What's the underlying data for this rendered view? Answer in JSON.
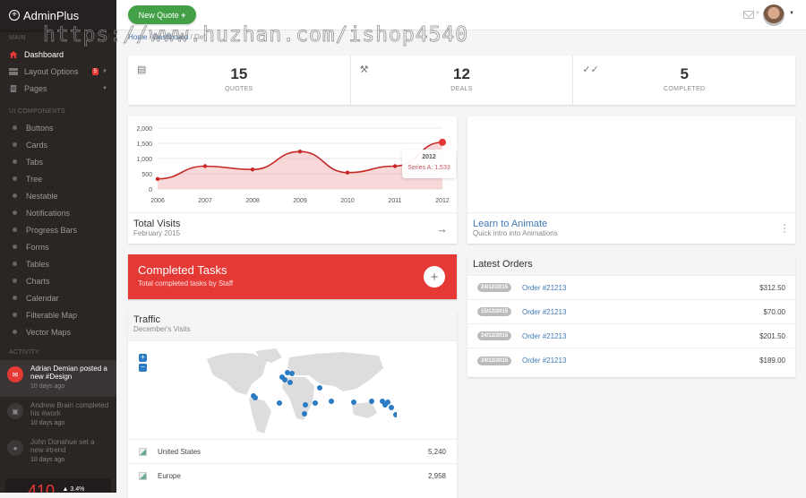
{
  "app": {
    "title": "AdminPlus"
  },
  "watermark": "https://www.huzhan.com/ishop4540",
  "sidebar": {
    "sections": {
      "main": "MAIN",
      "ui": "UI COMPONENTS",
      "activity": "ACTIVITY"
    },
    "main_items": [
      {
        "label": "Dashboard",
        "icon": "home-icon",
        "active": true
      },
      {
        "label": "Layout Options",
        "icon": "layout-icon",
        "badge": "5"
      },
      {
        "label": "Pages",
        "icon": "pages-icon"
      }
    ],
    "ui_items": [
      {
        "label": "Buttons"
      },
      {
        "label": "Cards"
      },
      {
        "label": "Tabs"
      },
      {
        "label": "Tree"
      },
      {
        "label": "Nestable"
      },
      {
        "label": "Notifications"
      },
      {
        "label": "Progress Bars"
      },
      {
        "label": "Forms"
      },
      {
        "label": "Tables"
      },
      {
        "label": "Charts"
      },
      {
        "label": "Calendar"
      },
      {
        "label": "Filterable Map"
      },
      {
        "label": "Vector Maps"
      }
    ],
    "activity": [
      {
        "text": "Adrian Demian posted a new #Design",
        "time": "10 days ago",
        "icon": "mail-icon"
      },
      {
        "text": "Andrew Brain completed his #work",
        "time": "10 days ago",
        "icon": "calendar-icon"
      },
      {
        "text": "John Donahue set a new #trend",
        "time": "10 days ago",
        "icon": "user-icon"
      }
    ],
    "stat": {
      "value": "410",
      "change": "▲ 3.4%"
    }
  },
  "topbar": {
    "new_quote": "New Quote",
    "plus": "+"
  },
  "breadcrumb": {
    "home": "Home",
    "sep": " / ",
    "dashboard": "Dashboard",
    "current": "Def"
  },
  "stats": [
    {
      "value": "15",
      "label": "QUOTES",
      "icon": "document-icon"
    },
    {
      "value": "12",
      "label": "DEALS",
      "icon": "gavel-icon"
    },
    {
      "value": "5",
      "label": "COMPLETED",
      "icon": "double-check-icon"
    }
  ],
  "chart_data": {
    "type": "area",
    "title": "Total Visits",
    "subtitle": "February 2015",
    "categories": [
      "2006",
      "2007",
      "2008",
      "2009",
      "2010",
      "2011",
      "2012"
    ],
    "series": [
      {
        "name": "Series A",
        "values": [
          330,
          750,
          640,
          1230,
          540,
          750,
          1533
        ]
      }
    ],
    "yticks": [
      "0",
      "500",
      "1,000",
      "1,500",
      "2,000"
    ],
    "ylim": [
      0,
      2000
    ],
    "grid": true,
    "tooltip": {
      "title": "2012",
      "text": "Series A: 1,533"
    },
    "color": "#c62828"
  },
  "anim_card": {
    "title": "Learn to Animate",
    "subtitle": "Quick intro into Animations"
  },
  "tasks": {
    "title": "Completed Tasks",
    "subtitle": "Total completed tasks by Staff"
  },
  "traffic": {
    "title": "Traffic",
    "subtitle": "December's Visits",
    "rows": [
      {
        "country": "United States",
        "value": "5,240"
      },
      {
        "country": "Europe",
        "value": "2,958"
      }
    ]
  },
  "orders": {
    "title": "Latest Orders",
    "rows": [
      {
        "date": "24/12/2015",
        "order": "Order #21213",
        "amount": "$312.50"
      },
      {
        "date": "15/12/2015",
        "order": "Order #21213",
        "amount": "$70.00"
      },
      {
        "date": "24/12/2015",
        "order": "Order #21213",
        "amount": "$201.50"
      },
      {
        "date": "24/12/2015",
        "order": "Order #21213",
        "amount": "$189.00"
      }
    ]
  }
}
